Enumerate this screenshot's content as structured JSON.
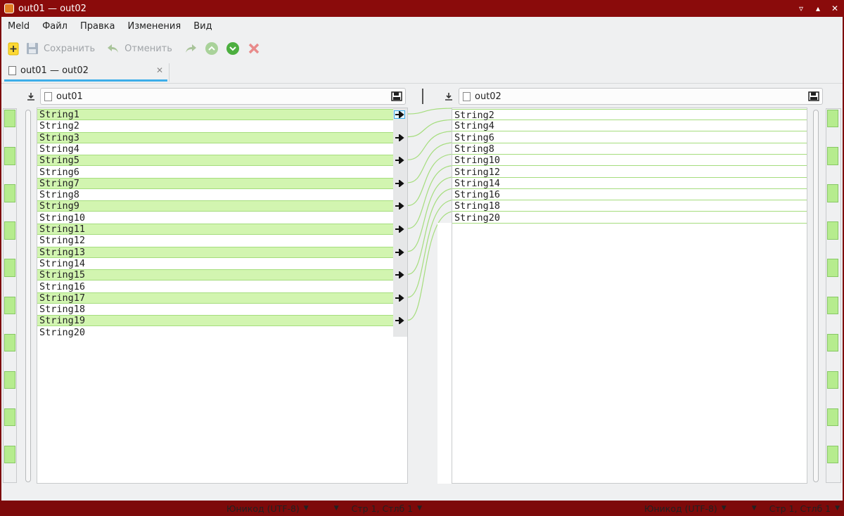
{
  "window": {
    "title": "out01 — out02"
  },
  "menu": [
    "Meld",
    "Файл",
    "Правка",
    "Изменения",
    "Вид"
  ],
  "toolbar": {
    "save_label": "Сохранить",
    "undo_label": "Отменить"
  },
  "tab": {
    "label": "out01 — out02"
  },
  "left": {
    "filename": "out01",
    "lines": [
      "String1",
      "String2",
      "String3",
      "String4",
      "String5",
      "String6",
      "String7",
      "String8",
      "String9",
      "String10",
      "String11",
      "String12",
      "String13",
      "String14",
      "String15",
      "String16",
      "String17",
      "String18",
      "String19",
      "String20"
    ],
    "changed_lines": [
      1,
      3,
      5,
      7,
      9,
      11,
      13,
      15,
      17,
      19
    ],
    "encoding": "Юникод (UTF-8)",
    "position": "Стр 1, Стлб 1"
  },
  "right": {
    "filename": "out02",
    "lines": [
      "String2",
      "String4",
      "String6",
      "String8",
      "String10",
      "String12",
      "String14",
      "String16",
      "String18",
      "String20"
    ],
    "encoding": "Юникод (UTF-8)",
    "position": "Стр 1, Стлб 1"
  },
  "colors": {
    "accent": "#3daee9",
    "insert_fill": "#d2f5b0",
    "insert_border": "#a5dd7d",
    "titlebar": "#8a0b0b"
  },
  "icons": {
    "new": "new-comparison-icon",
    "save": "save-icon",
    "undo": "undo-icon",
    "redo": "redo-icon",
    "prev": "previous-change-icon",
    "next": "next-change-icon",
    "stop": "stop-icon"
  }
}
